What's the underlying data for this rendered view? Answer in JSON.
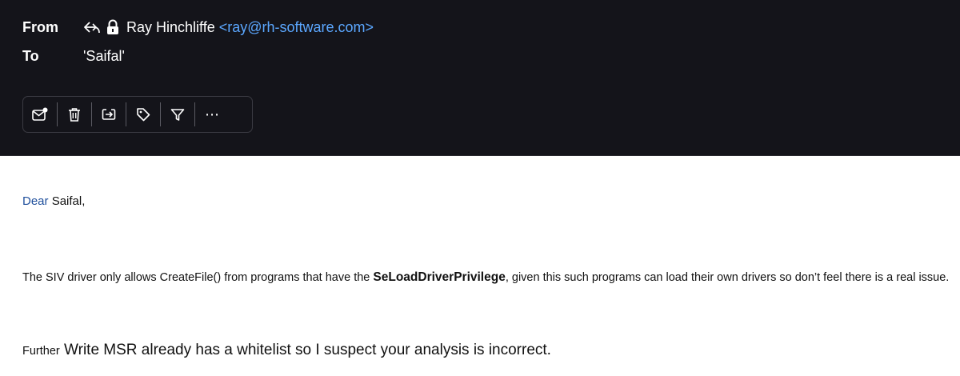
{
  "header": {
    "from_label": "From",
    "to_label": "To",
    "sender_name": "Ray Hinchliffe",
    "sender_email": "<ray@rh-software.com>",
    "recipient": "'Saifal'",
    "icons": [
      "reply-icon",
      "lock-icon"
    ]
  },
  "toolbar": {
    "buttons": [
      "mark-unread-icon",
      "delete-icon",
      "move-icon",
      "tag-icon",
      "filter-icon",
      "more-icon"
    ],
    "more_label": "⋯"
  },
  "body": {
    "greeting_word": "Dear",
    "greeting_name": "Saifal,",
    "para1_start": "The SIV driver only allows CreateFile() from programs that have the ",
    "para1_bold": "SeLoadDriverPrivilege",
    "para1_end": ", given this such programs can load their own drivers so don’t feel there is a real issue.",
    "para2_small": "Further",
    "para2_big": " Write MSR already has a whitelist so I suspect your analysis is incorrect."
  },
  "colors": {
    "header_bg": "#14141a",
    "email_link": "#5ba7ff",
    "dear_color": "#1f4f9c"
  }
}
